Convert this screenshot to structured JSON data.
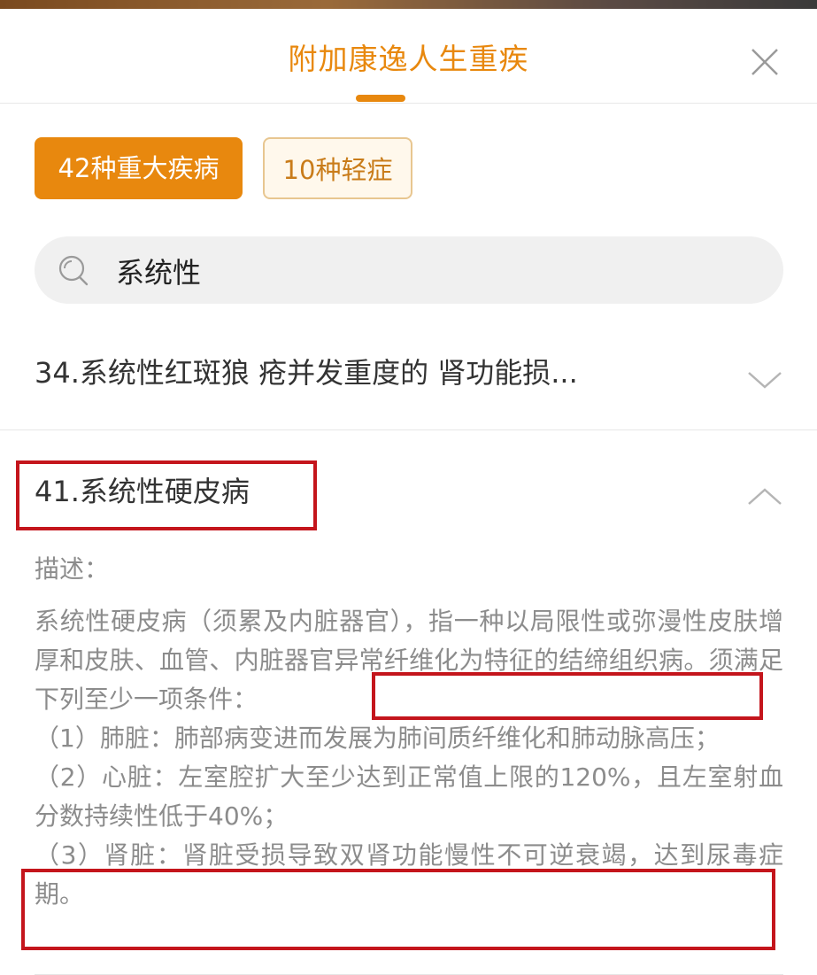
{
  "header": {
    "title": "附加康逸人生重疾",
    "close_icon": "close-icon"
  },
  "tabs": [
    {
      "label": "42种重大疾病",
      "active": true
    },
    {
      "label": "10种轻症",
      "active": false
    }
  ],
  "search": {
    "icon": "search-icon",
    "value": "系统性"
  },
  "results": [
    {
      "title": "34.系统性红斑狼 疮并发重度的 肾功能损...",
      "expanded": false,
      "toggle_icon": "chevron-down-icon"
    },
    {
      "title": "41.系统性硬皮病",
      "expanded": true,
      "toggle_icon": "chevron-up-icon",
      "description_label": "描述：",
      "description_intro": "系统性硬皮病（须累及内脏器官），指一种以局限性或弥漫性皮肤增厚和皮肤、血管、内脏器官异常纤维化为特征的结缔组织病。",
      "description_requirement": "须满足下列至少一项条件：",
      "conditions": [
        "（1）肺脏：肺部病变进而发展为肺间质纤维化和肺动脉高压；",
        "（2）心脏：左室腔扩大至少达到正常值上限的120%，且左室射血分数持续性低于40%；",
        "（3）肾脏：肾脏受损导致双肾功能慢性不可逆衰竭，达到尿毒症期。"
      ]
    }
  ],
  "colors": {
    "accent": "#e8880e",
    "annotation_red": "#c4151c",
    "text_primary": "#333333",
    "text_secondary": "#8c8c8c"
  }
}
